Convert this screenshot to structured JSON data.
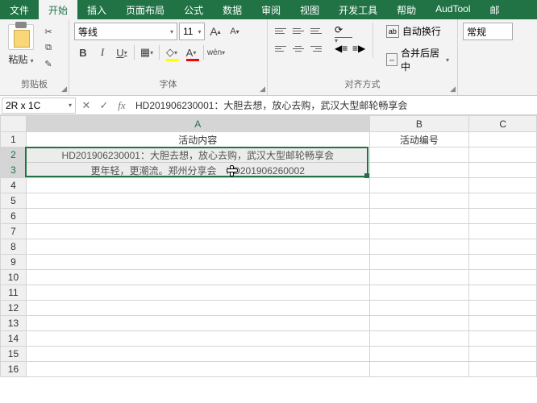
{
  "tabs": [
    "文件",
    "开始",
    "插入",
    "页面布局",
    "公式",
    "数据",
    "审阅",
    "视图",
    "开发工具",
    "帮助",
    "AudTool",
    "邮"
  ],
  "active_tab": 1,
  "ribbon": {
    "clipboard": {
      "paste": "粘贴",
      "label": "剪贴板"
    },
    "font": {
      "name": "等线",
      "size": "11",
      "label": "字体",
      "grow": "A",
      "shrink": "A",
      "bold": "B",
      "italic": "I",
      "underline": "U",
      "ruby": "wén"
    },
    "align": {
      "label": "对齐方式",
      "wrap": "自动换行",
      "merge": "合并后居中",
      "wrap_icon": "ab",
      "merge_icon": "⇔"
    },
    "number": {
      "format": "常规"
    }
  },
  "namebox": "2R x 1C",
  "formula": "HD201906230001：大胆去想，放心去购，武汉大型邮轮畅享会",
  "columns": [
    "A",
    "B",
    "C"
  ],
  "cells": {
    "A1": "活动内容",
    "B1": "活动编号",
    "A2": "HD201906230001：大胆去想，放心去购，武汉大型邮轮畅享会",
    "A3": "更年轻，更潮流。郑州分享会　HD201906260002"
  },
  "rows": 16
}
